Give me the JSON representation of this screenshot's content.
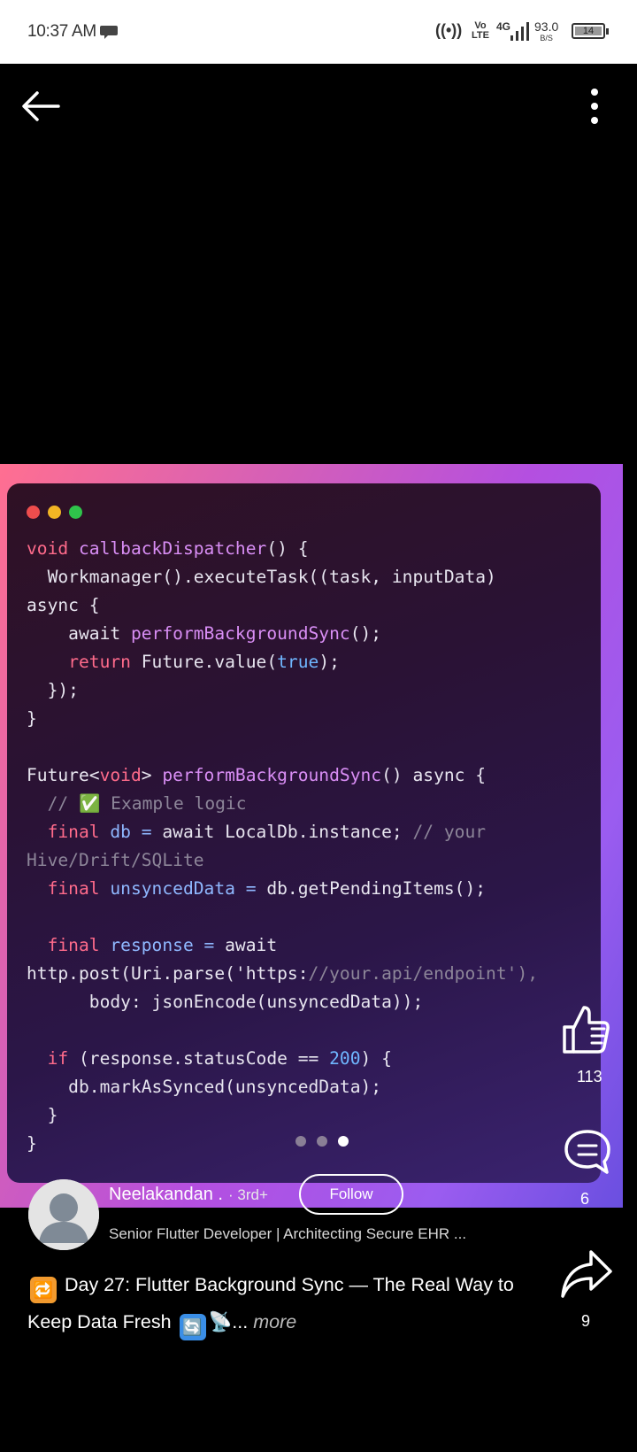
{
  "status_bar": {
    "time": "10:37 AM",
    "hotspot": "((•))",
    "volte": [
      "Vo",
      "LTE"
    ],
    "network": "4G",
    "speed": "93.0",
    "speed_unit": "B/S",
    "battery": "14",
    "battery_level": 0.14
  },
  "nav": {
    "back_icon": "arrow-left-icon",
    "menu_icon": "more-vertical-icon"
  },
  "code_image": {
    "window_dots": [
      "#ee4d4d",
      "#f2b524",
      "#2fc44b"
    ],
    "lines": [
      "void callbackDispatcher() {",
      "  Workmanager().executeTask((task, inputData)",
      "async {",
      "    await performBackgroundSync();",
      "    return Future.value(true);",
      "  });",
      "}",
      "",
      "Future<void> performBackgroundSync() async {",
      "  // ✅ Example logic",
      "  final db = await LocalDb.instance; // your",
      "Hive/Drift/SQLite",
      "  final unsyncedData = db.getPendingItems();",
      "",
      "  final response = await",
      "http.post(Uri.parse('https://your.api/endpoint'),",
      "      body: jsonEncode(unsyncedData));",
      "",
      "  if (response.statusCode == 200) {",
      "    db.markAsSynced(unsyncedData);",
      "  }",
      "}"
    ],
    "pager": {
      "count": 3,
      "active": 2
    }
  },
  "actions": {
    "likes": "113",
    "comments": "6",
    "shares": "9"
  },
  "author": {
    "name": "Neelakandan .",
    "degree": "· 3rd+",
    "follow_label": "Follow",
    "headline": "Senior Flutter Developer | Architecting Secure EHR ..."
  },
  "post": {
    "lead_emoji": "🔁",
    "text_1": "Day 27: Flutter Background Sync — The Real Way to",
    "text_2": "Keep Data Fresh",
    "emoji_2": "🔄",
    "emoji_3": "📡",
    "ellipsis": "...",
    "more_label": "more"
  },
  "colors": {
    "background": "#000000",
    "gradient_start": "#ff6f91",
    "gradient_end": "#6a4fe0",
    "keyword": "#ff6b8b",
    "function": "#d98ef5"
  }
}
